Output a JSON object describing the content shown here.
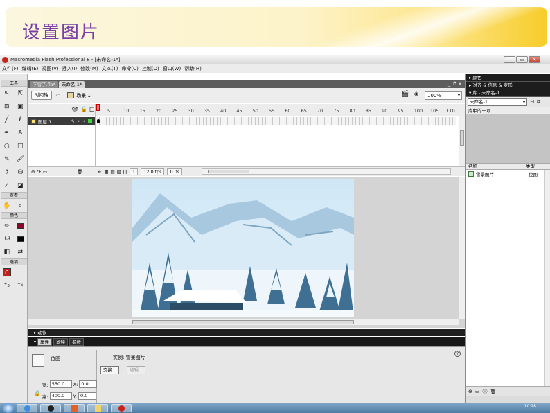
{
  "slide": {
    "title": "设置图片"
  },
  "window": {
    "title": "Macromedia Flash Professional 8 - [未命名-1*]",
    "controls": {
      "minimize": "—",
      "restore": "▭",
      "close": "✕"
    }
  },
  "menu": [
    "文件(F)",
    "编辑(E)",
    "视图(V)",
    "插入(I)",
    "修改(M)",
    "文本(T)",
    "命令(C)",
    "控制(O)",
    "窗口(W)",
    "帮助(H)"
  ],
  "tools": {
    "title": "工具",
    "view_label": "查看",
    "color_label": "颜色",
    "options_label": "选项"
  },
  "doc_tabs": [
    "下雪了.fla*",
    "未命名-1*"
  ],
  "doc_tabs_controls": "_ ♬ ×",
  "editbar": {
    "timeline_button": "时间轴",
    "scene": "场景 1",
    "zoom": "100%"
  },
  "timeline": {
    "ruler_ticks": [
      "5",
      "10",
      "15",
      "20",
      "25",
      "30",
      "35",
      "40",
      "45",
      "50",
      "55",
      "60",
      "65",
      "70",
      "75",
      "80",
      "85",
      "90",
      "95",
      "100",
      "105",
      "110"
    ],
    "layer_name": "图层 1",
    "current_frame": "1",
    "fps": "12.0 fps",
    "time": "0.0s"
  },
  "panels": {
    "actions": "动作",
    "properties_tabs": [
      "属性",
      "滤镜",
      "参数"
    ],
    "bitmap_type": "位图",
    "instance_label": "实例:  雪景图片",
    "swap_button": "交换...",
    "edit_button": "编辑...",
    "width_label": "宽:",
    "width_value": "550.0",
    "height_label": "高:",
    "height_value": "400.0",
    "x_label": "X:",
    "x_value": "0.0",
    "y_label": "Y:",
    "y_value": "0.0",
    "help": "?"
  },
  "right_panel": {
    "color_bar": "▸ 颜色",
    "align_bar": "▸ 对齐 & 信息 & 变形",
    "library_bar": "▾ 库 - 未命名-1",
    "library_select": "未命名-1",
    "item_count": "库中的一项",
    "col_name": "名称",
    "col_type": "类型",
    "items": [
      {
        "name": "雪景图片",
        "type": "位图"
      }
    ]
  },
  "taskbar": {
    "clock": "10:28"
  },
  "colors": {
    "slide_title": "#7a3fa5",
    "panel_dark": "#1d1d1d",
    "playhead": "#e04040"
  }
}
